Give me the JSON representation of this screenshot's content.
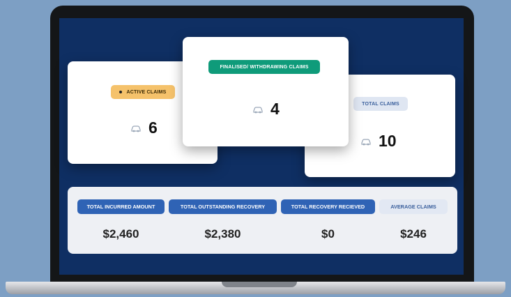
{
  "colors": {
    "background": "#7d9fc4",
    "screen": "#0f2f63",
    "active_pill": "#f5c26b",
    "finalised_pill": "#0f9b7a",
    "total_pill": "#dfe6f2",
    "stat_label": "#2f63b5"
  },
  "cards": {
    "active": {
      "label": "ACTIVE CLAIMS",
      "value": "6",
      "icon": "car-icon"
    },
    "finalised": {
      "label": "FINALISED/ WITHDRAWING CLAIMS",
      "value": "4",
      "icon": "car-icon"
    },
    "total": {
      "label": "TOTAL CLAIMS",
      "value": "10",
      "icon": "car-icon"
    }
  },
  "stats": [
    {
      "label": "TOTAL INCURRED AMOUNT",
      "value": "$2,460"
    },
    {
      "label": "TOTAL OUTSTANDING RECOVERY",
      "value": "$2,380"
    },
    {
      "label": "TOTAL RECOVERY RECIEVED",
      "value": "$0"
    },
    {
      "label": "AVERAGE CLAIMS",
      "value": "$246"
    }
  ]
}
